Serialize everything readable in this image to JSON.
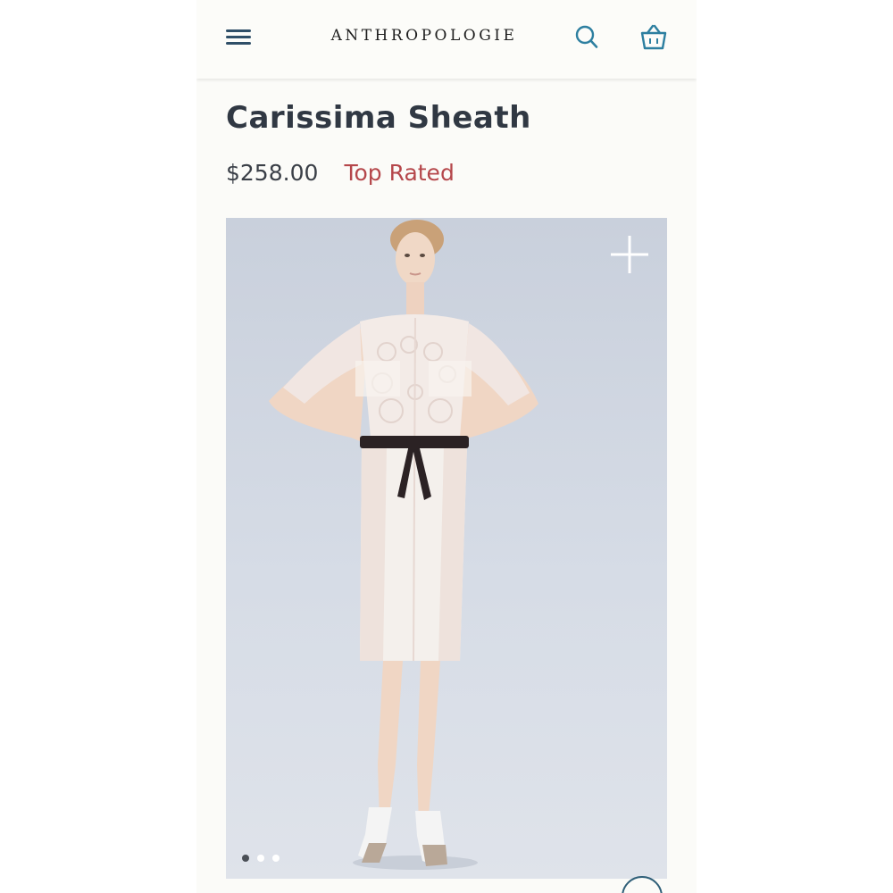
{
  "header": {
    "brand": "ANTHROPOLOGIE",
    "menu_icon": "hamburger-menu-icon",
    "search_icon": "search-icon",
    "bag_icon": "shopping-bag-icon"
  },
  "product": {
    "title": "Carissima Sheath",
    "price": "$258.00",
    "badge": "Top Rated"
  },
  "gallery": {
    "zoom_icon": "plus-icon",
    "image_count": 3,
    "active_index": 0
  },
  "colors": {
    "nav_icon": "#2f4f68",
    "accent_icon": "#2d7fa0",
    "badge": "#b5474b"
  }
}
